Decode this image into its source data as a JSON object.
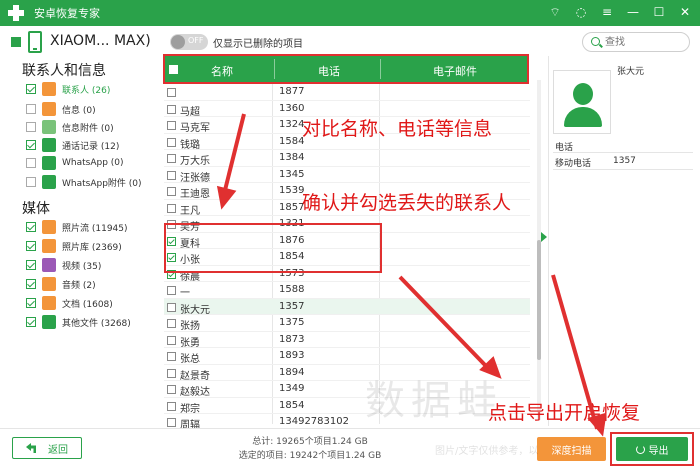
{
  "window": {
    "title": "安卓恢复专家"
  },
  "device": {
    "name": "XIAOM... MAX)"
  },
  "filter": {
    "toggle_state": "OFF",
    "label": "仅显示已删除的项目"
  },
  "search": {
    "placeholder": "查找"
  },
  "sidebar": {
    "section1": "联系人和信息",
    "section2": "媒体",
    "items": [
      {
        "label": "联系人 (26)",
        "active": true,
        "icon": "contacts-icon",
        "color": "#f3953a",
        "checked": true
      },
      {
        "label": "信息 (0)",
        "icon": "message-icon",
        "color": "#f3953a",
        "checked": false
      },
      {
        "label": "信息附件 (0)",
        "icon": "attachment-icon",
        "color": "#7ac37a",
        "checked": false
      },
      {
        "label": "通话记录 (12)",
        "icon": "phone-icon",
        "color": "#2aa24a",
        "checked": true
      },
      {
        "label": "WhatsApp (0)",
        "icon": "whatsapp-icon",
        "color": "#2aa24a",
        "checked": false
      },
      {
        "label": "WhatsApp附件 (0)",
        "icon": "whatsapp-attachment-icon",
        "color": "#2aa24a",
        "checked": false
      },
      {
        "label": "照片流 (11945)",
        "icon": "photo-stream-icon",
        "color": "#f3953a",
        "checked": true
      },
      {
        "label": "照片库 (2369)",
        "icon": "photo-library-icon",
        "color": "#f3953a",
        "checked": true
      },
      {
        "label": "视频 (35)",
        "icon": "video-icon",
        "color": "#9b59b6",
        "checked": true
      },
      {
        "label": "音频 (2)",
        "icon": "audio-icon",
        "color": "#f3953a",
        "checked": true
      },
      {
        "label": "文档 (1608)",
        "icon": "document-icon",
        "color": "#f3953a",
        "checked": true
      },
      {
        "label": "其他文件 (3268)",
        "icon": "other-files-icon",
        "color": "#2aa24a",
        "checked": true
      }
    ]
  },
  "table": {
    "headers": [
      "名称",
      "电话",
      "电子邮件"
    ],
    "rows": [
      {
        "name": "",
        "phone": "1877",
        "checked": false
      },
      {
        "name": "马超",
        "phone": "1360",
        "checked": false
      },
      {
        "name": "马克军",
        "phone": "1324",
        "checked": false
      },
      {
        "name": "钱璐",
        "phone": "1584",
        "checked": false
      },
      {
        "name": "万大乐",
        "phone": "1384",
        "checked": false
      },
      {
        "name": "汪张德",
        "phone": "1345",
        "checked": false
      },
      {
        "name": "王迪恩",
        "phone": "1539",
        "checked": false
      },
      {
        "name": "王凡",
        "phone": "1857",
        "checked": false
      },
      {
        "name": "吴芳",
        "phone": "1321",
        "checked": false
      },
      {
        "name": "夏科",
        "phone": "1876",
        "checked": true
      },
      {
        "name": "小张",
        "phone": "1854",
        "checked": true
      },
      {
        "name": "徐晨",
        "phone": "1573",
        "checked": true
      },
      {
        "name": "一",
        "phone": "1588",
        "checked": false
      },
      {
        "name": "张大元",
        "phone": "1357",
        "checked": false,
        "selected": true
      },
      {
        "name": "张扬",
        "phone": "1375",
        "checked": false
      },
      {
        "name": "张勇",
        "phone": "1873",
        "checked": false
      },
      {
        "name": "张总",
        "phone": "1893",
        "checked": false
      },
      {
        "name": "赵景奇",
        "phone": "1894",
        "checked": false
      },
      {
        "name": "赵毅达",
        "phone": "1349",
        "checked": false
      },
      {
        "name": "郑宗",
        "phone": "1854",
        "checked": false
      },
      {
        "name": "周辐",
        "phone": "13492783102",
        "checked": false
      }
    ]
  },
  "detail": {
    "name": "张大元",
    "section": "电话",
    "key": "移动电话",
    "value": "1357"
  },
  "footer": {
    "back": "返回",
    "total": "总计: 19265个项目1.24 GB",
    "selected": "选定的项目: 19242个项目1.24 GB",
    "deep_scan": "深度扫描",
    "export": "导出"
  },
  "annotations": {
    "a1": "对比名称、电话等信息",
    "a2": "确认并勾选丢失的联系人",
    "a3": "点击导出开启恢复",
    "watermark": "数据蛙",
    "watermark_sub": "图片/文字仅供参考，以"
  },
  "colors": {
    "accent": "#2aa24a",
    "annotation": "#e03030",
    "warning": "#f3953a"
  }
}
